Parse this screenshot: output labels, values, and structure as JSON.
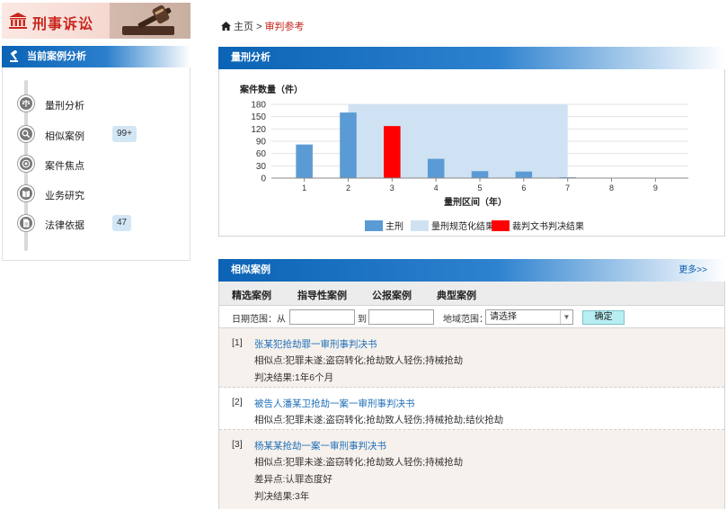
{
  "banner": {
    "title": "刑事诉讼"
  },
  "sidebar": {
    "header": "当前案例分析",
    "items": [
      {
        "label": "量刑分析",
        "icon": "scale-icon",
        "count": ""
      },
      {
        "label": "相似案例",
        "icon": "magnify-icon",
        "count": "99+"
      },
      {
        "label": "案件焦点",
        "icon": "target-icon",
        "count": ""
      },
      {
        "label": "业务研究",
        "icon": "book-icon",
        "count": ""
      },
      {
        "label": "法律依据",
        "icon": "document-icon",
        "count": "47"
      }
    ]
  },
  "breadcrumb": {
    "home": "主页",
    "sep": ">",
    "current": "审判参考"
  },
  "sentencing": {
    "title": "量刑分析",
    "chart_data": {
      "type": "bar",
      "ylabel": "案件数量（件）",
      "xlabel": "量刑区间（年）",
      "categories": [
        "1",
        "2",
        "3",
        "4",
        "5",
        "6",
        "7",
        "8",
        "9"
      ],
      "yticks": [
        "180",
        "150",
        "120",
        "90",
        "60",
        "30",
        "0"
      ],
      "ylim": [
        0,
        180
      ],
      "series": [
        {
          "name": "主刑",
          "color": "#5b9bd5",
          "values": [
            82,
            160,
            0,
            47,
            17,
            16,
            2,
            1,
            1
          ]
        },
        {
          "name": "裁判文书判决结果",
          "color": "#ff0000",
          "values": [
            0,
            0,
            127,
            0,
            0,
            0,
            0,
            0,
            0
          ]
        }
      ],
      "range_band": {
        "name": "量刑规范化结果",
        "color": "#cfe2f3",
        "from": 2,
        "to": 7
      },
      "legend": [
        "主刑",
        "量刑规范化结果",
        "裁判文书判决结果"
      ],
      "legend_position": "bottom",
      "grid": true
    }
  },
  "similar": {
    "title": "相似案例",
    "more": "更多>>",
    "tabs": [
      "精选案例",
      "指导性案例",
      "公报案例",
      "典型案例"
    ],
    "filter": {
      "date_label": "日期范围：从",
      "to_label": "到",
      "region_label": "地域范围：",
      "region_value": "请选择",
      "confirm": "确定"
    },
    "cases": [
      {
        "num": "[1]",
        "title": "张某犯抢劫罪一审刑事判决书",
        "lines": [
          "相似点:犯罪未遂;盗窃转化;抢劫致人轻伤;持械抢劫",
          "判决结果:1年6个月"
        ]
      },
      {
        "num": "[2]",
        "title": "被告人潘某卫抢劫一案一审刑事判决书",
        "lines": [
          "相似点:犯罪未遂;盗窃转化;抢劫致人轻伤;持械抢劫;结伙抢劫"
        ]
      },
      {
        "num": "[3]",
        "title": "杨某某抢劫一案一审刑事判决书",
        "lines": [
          "相似点:犯罪未遂;盗窃转化;抢劫致人轻伤;持械抢劫",
          "差异点:认罪态度好",
          "判决结果:3年"
        ]
      }
    ]
  }
}
